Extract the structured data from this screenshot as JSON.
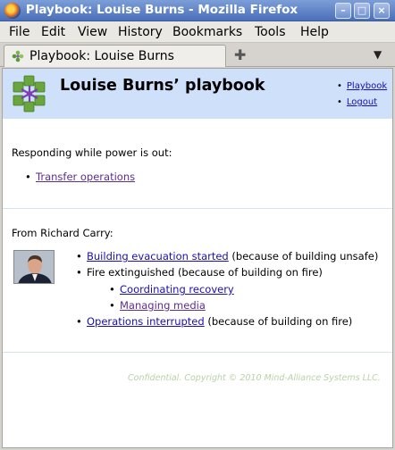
{
  "window": {
    "title": "Playbook: Louise Burns - Mozilla Firefox"
  },
  "menu": {
    "items": [
      "File",
      "Edit",
      "View",
      "History",
      "Bookmarks",
      "Tools",
      "Help"
    ]
  },
  "tabs": [
    {
      "label": "Playbook: Louise Burns"
    }
  ],
  "header": {
    "title": "Louise Burns’ playbook",
    "links": [
      "Playbook",
      "Logout"
    ]
  },
  "section1": {
    "label": "Responding while power is out:",
    "items": [
      {
        "text": "Transfer operations",
        "link": true
      }
    ]
  },
  "section2": {
    "label": "From Richard Carry:",
    "items": [
      {
        "link_text": "Building evacuation started",
        "suffix": " (because of building unsafe)"
      },
      {
        "text": "Fire extinguished (because of building on fire)",
        "children": [
          "Coordinating recovery",
          "Managing media"
        ]
      },
      {
        "link_text": "Operations interrupted",
        "suffix": " (because of building on fire)"
      }
    ]
  },
  "footer": {
    "copyright": "Confidential. Copyright © 2010 Mind-Alliance Systems LLC."
  },
  "colors": {
    "header_bg": "#cfe0fb",
    "link_visited": "#5a2f8f",
    "link": "#1a0fb0",
    "titlebar": "#4a6fb9"
  }
}
